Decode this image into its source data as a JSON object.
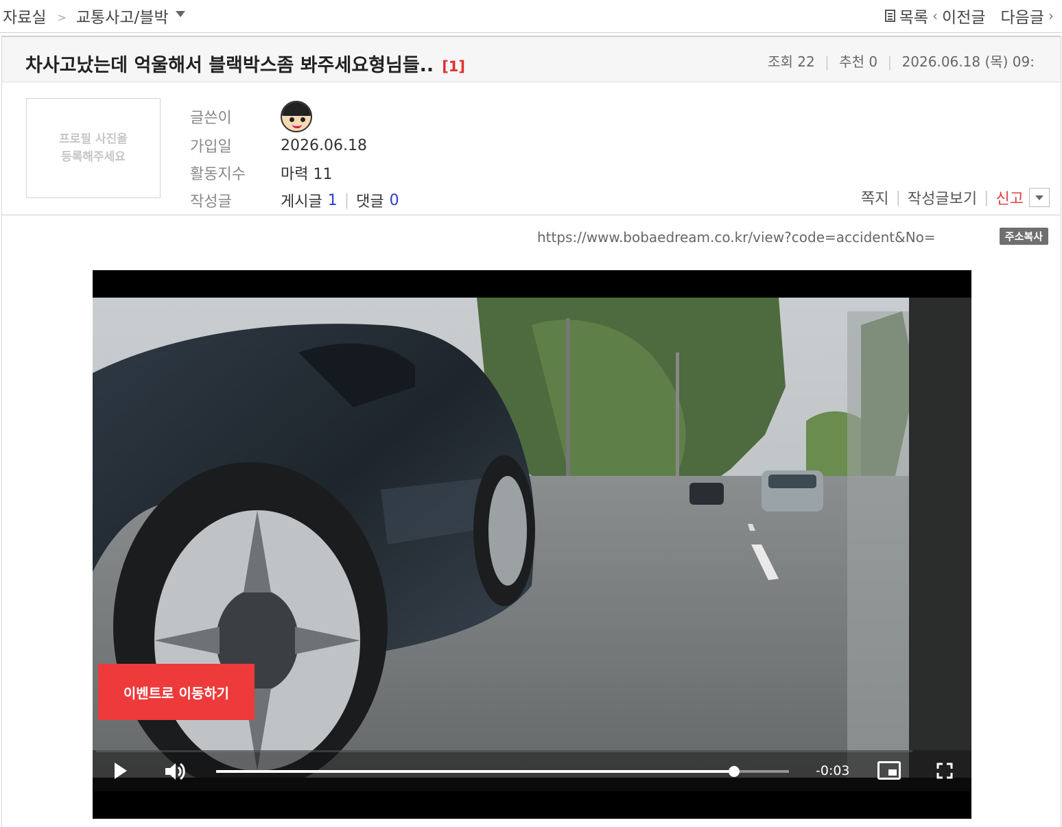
{
  "breadcrumb": {
    "root": "자료실",
    "separator": ">",
    "category": "교통사고/블박"
  },
  "topnav": {
    "list": "목록",
    "prev": "이전글",
    "next": "다음글"
  },
  "post": {
    "title": "차사고났는데 억울해서 블랙박스좀 봐주세요형님들..",
    "comment_count": "[1]",
    "views_label": "조회",
    "views": "22",
    "recommend_label": "추천",
    "recommend": "0",
    "datetime": "2026.06.18 (목) 09:"
  },
  "author": {
    "photo_placeholder_line1": "프로필 사진을",
    "photo_placeholder_line2": "등록해주세요",
    "writer_label": "글쓴이",
    "joined_label": "가입일",
    "joined": "2026.06.18",
    "activity_label": "활동지수",
    "activity_value": "마력 11",
    "written_label": "작성글",
    "posts_label": "게시글",
    "posts": "1",
    "comments_label": "댓글",
    "comments": "0"
  },
  "actions": {
    "message": "쪽지",
    "view_posts": "작성글보기",
    "report": "신고"
  },
  "url_line": {
    "url": "https://www.bobaedream.co.kr/view?code=accident&No=",
    "copy_button": "주소복사"
  },
  "video": {
    "event_button": "이벤트로 이동하기",
    "time_remaining": "-0:03",
    "progress": 0.904,
    "buffered": 1.0
  },
  "colors": {
    "accent_red": "#ee3a3a",
    "link_blue": "#2a3cc8",
    "comment_count_red": "#e03030"
  }
}
